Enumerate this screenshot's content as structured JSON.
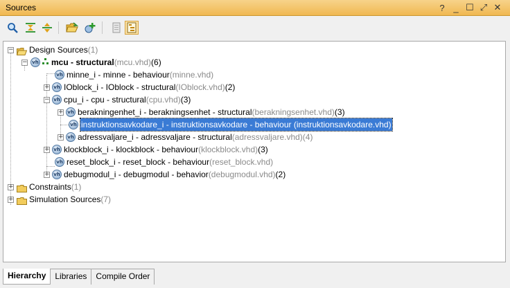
{
  "window": {
    "title": "Sources",
    "help_glyph": "?",
    "minimize_glyph": "_",
    "maximize_glyph": "☐",
    "restore_glyph": "⤢",
    "close_glyph": "✕"
  },
  "toolbar": {
    "icons": [
      "search-icon",
      "collapse-all-icon",
      "expand-all-icon",
      "open-folder-icon",
      "add-sources-icon",
      "properties-icon",
      "show-hierarchy-icon"
    ],
    "colors": {
      "accent": "#f0b851",
      "selection": "#3a7bd5"
    }
  },
  "tree": {
    "design_sources": {
      "label": "Design Sources",
      "count": " (1)"
    },
    "mcu": {
      "label": "mcu - structural",
      "file": " (mcu.vhd)",
      "count": " (6)"
    },
    "minne": {
      "label": "minne_i - minne - behaviour",
      "file": " (minne.vhd)"
    },
    "ioblock": {
      "label": "IOblock_i - IOblock - structural",
      "file": " (IOblock.vhd)",
      "count": " (2)"
    },
    "cpu": {
      "label": "cpu_i - cpu - structural",
      "file": " (cpu.vhd)",
      "count": " (3)"
    },
    "berakningenhet": {
      "label": "berakningenhet_i - berakningsenhet - structural",
      "file": " (berakningsenhet.vhd)",
      "count": " (3)"
    },
    "instruktionsavkodare": {
      "label": "instruktionsavkodare_i - instruktionsavkodare - behaviour",
      "file": " (instruktionsavkodare.vhd)"
    },
    "adressvaljare": {
      "label": "adressvaljare_i - adressvaljare - structural",
      "file": " (adressvaljare.vhd)",
      "count": " (4)"
    },
    "klockblock": {
      "label": "klockblock_i - klockblock - behaviour",
      "file": " (klockblock.vhd)",
      "count": " (3)"
    },
    "reset_block": {
      "label": "reset_block_i - reset_block - behaviour",
      "file": " (reset_block.vhd)"
    },
    "debugmodul": {
      "label": "debugmodul_i - debugmodul - behavior",
      "file": " (debugmodul.vhd)",
      "count": " (2)"
    },
    "constraints": {
      "label": "Constraints",
      "count": " (1)"
    },
    "simulation_sources": {
      "label": "Simulation Sources",
      "count": " (7)"
    }
  },
  "tabs": [
    {
      "label": "Hierarchy",
      "active": true
    },
    {
      "label": "Libraries",
      "active": false
    },
    {
      "label": "Compile Order",
      "active": false
    }
  ]
}
